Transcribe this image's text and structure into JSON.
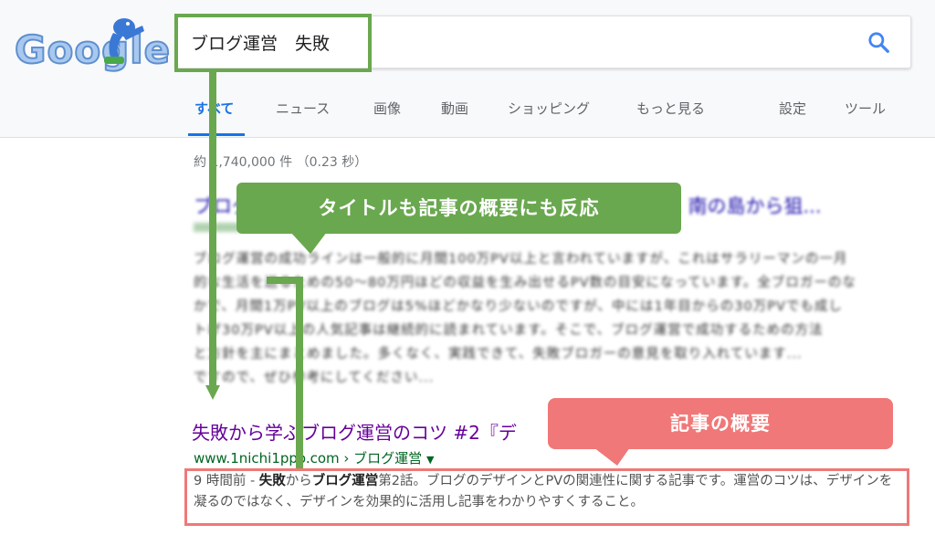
{
  "logo": {
    "text": "Google",
    "icon": "runner-mascot-icon"
  },
  "search": {
    "query": "ブログ運営　失敗",
    "placeholder": "",
    "icon": "search-icon"
  },
  "tabs": [
    {
      "label": "すべて",
      "active": true
    },
    {
      "label": "ニュース"
    },
    {
      "label": "画像"
    },
    {
      "label": "動画"
    },
    {
      "label": "ショッピング"
    },
    {
      "label": "もっと見る"
    },
    {
      "label": "設定"
    },
    {
      "label": "ツール"
    }
  ],
  "result_stats": "約 1,740,000 件 （0.23 秒）",
  "result1": {
    "title": "ブログ運営の成功ラインは一般的に月間100万PV以上 ... 南の島から狙...",
    "snippet_lines": [
      "ブログ運営の成功ラインは一般的に月間100万PV以上と言われていますが、これはサラリーマンの一月",
      "的な生活を送るための50〜80万円ほどの収益を生み出せるPV数の目安になっています。全ブロガーのな",
      "かで、月間1万PV以上のブログは5%ほどかなり少ないのですが、中には1年目からの30万PVでも成し",
      "トげ30万PV以上の人気記事は継続的に読まれています。そこで、ブログ運営で成功するための方法",
      "と方針を主にまとめました。多くなく、実践できて、失敗ブロガーの意見を取り入れています...",
      "ですので、ぜひ参考にしてください..."
    ]
  },
  "result2": {
    "title": "失敗から学ぶブログ運営のコツ #2『デ",
    "url": "www.1nichi1ppo.com › ブログ運営",
    "url_arrow": "▼",
    "snippet_time": "9 時間前 - ",
    "snippet_b1": "失敗",
    "snippet_t1": "から",
    "snippet_b2": "ブログ運営",
    "snippet_t2": "第2話。ブログのデザインとPVの関連性に関する記事です。運営のコツは、デザインを凝るのではなく、デザインを効果的に活用し記事をわかりやすくすること。"
  },
  "annotations": {
    "green_label": "タイトルも記事の概要にも反応",
    "pink_label": "記事の概要"
  },
  "colors": {
    "accent_blue": "#1a73e8",
    "link_blue": "#1a0dab",
    "visited_purple": "#660099",
    "url_green": "#006621",
    "annotation_green": "#6aa84f",
    "annotation_pink": "#f07878"
  }
}
